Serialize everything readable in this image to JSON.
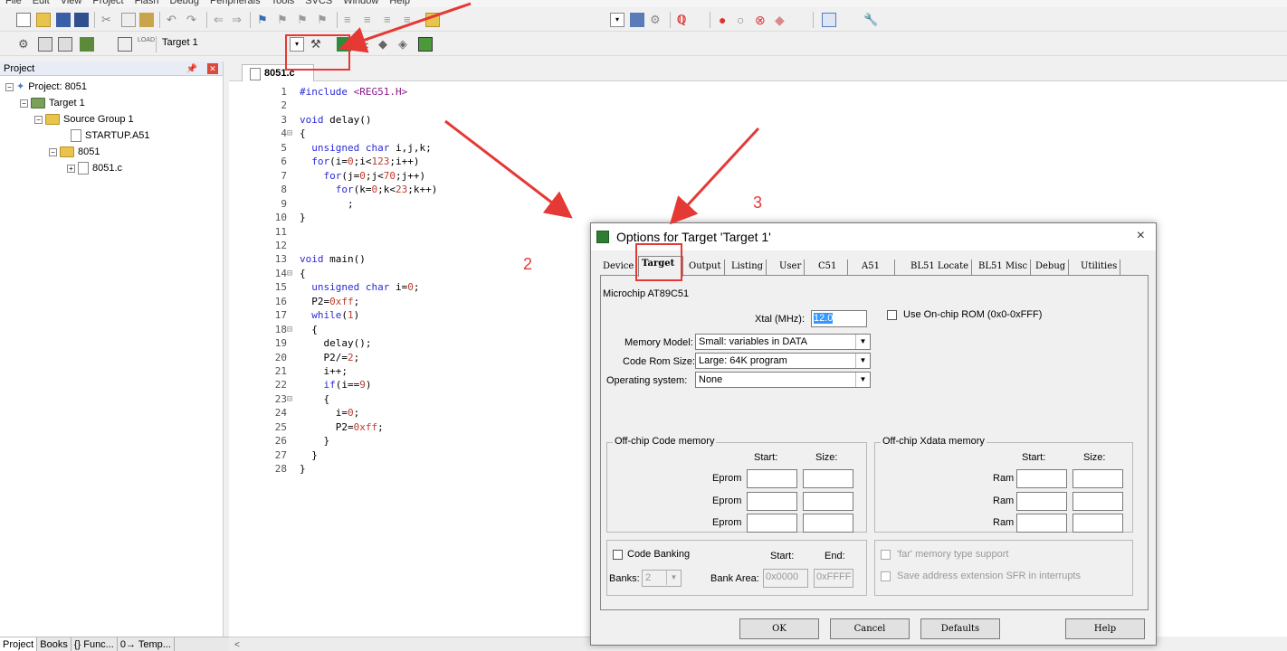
{
  "menu": [
    "File",
    "Edit",
    "View",
    "Project",
    "Flash",
    "Debug",
    "Peripherals",
    "Tools",
    "SVCS",
    "Window",
    "Help"
  ],
  "toolbar": {
    "target_select": "Target 1"
  },
  "project_panel": {
    "title": "Project",
    "tree": [
      {
        "label": "Project: 8051"
      },
      {
        "label": "Target 1"
      },
      {
        "label": "Source Group 1"
      },
      {
        "label": "STARTUP.A51"
      },
      {
        "label": "8051"
      },
      {
        "label": "8051.c"
      }
    ],
    "bottom_tabs": [
      "Project",
      "Books",
      "{} Func...",
      "0→ Temp..."
    ]
  },
  "editor": {
    "tab": "8051.c",
    "line_numbers": [
      "1",
      "2",
      "3",
      "4",
      "5",
      "6",
      "7",
      "8",
      "9",
      "10",
      "11",
      "12",
      "13",
      "14",
      "15",
      "16",
      "17",
      "18",
      "19",
      "20",
      "21",
      "22",
      "23",
      "24",
      "25",
      "26",
      "27",
      "28"
    ]
  },
  "dialog": {
    "title": "Options for Target 'Target 1'",
    "close": "×",
    "tabs": [
      "Device",
      "Target",
      "Output",
      "Listing",
      "User",
      "C51",
      "A51",
      "BL51 Locate",
      "BL51 Misc",
      "Debug",
      "Utilities"
    ],
    "device": "Microchip AT89C51",
    "xtal_label": "Xtal (MHz):",
    "xtal_value": "12.0",
    "onchip_rom_label": "Use On-chip ROM (0x0-0xFFF)",
    "memory_model_label": "Memory Model:",
    "memory_model_value": "Small: variables in DATA",
    "code_rom_label": "Code Rom Size:",
    "code_rom_value": "Large: 64K program",
    "os_label": "Operating system:",
    "os_value": "None",
    "offchip_code_title": "Off-chip Code memory",
    "offchip_xdata_title": "Off-chip Xdata memory",
    "start_label": "Start:",
    "size_label": "Size:",
    "eprom_label": "Eprom",
    "ram_label": "Ram",
    "code_banking_label": "Code Banking",
    "banking_start_label": "Start:",
    "banking_end_label": "End:",
    "banks_label": "Banks:",
    "banks_value": "2",
    "bank_area_label": "Bank Area:",
    "bank_start_value": "0x0000",
    "bank_end_value": "0xFFFF",
    "far_label": "'far' memory type support",
    "save_sfr_label": "Save address extension SFR in interrupts",
    "buttons": {
      "ok": "OK",
      "cancel": "Cancel",
      "defaults": "Defaults",
      "help": "Help"
    }
  },
  "annotations": {
    "step2": "2",
    "step3": "3",
    "color": "#e53935"
  }
}
